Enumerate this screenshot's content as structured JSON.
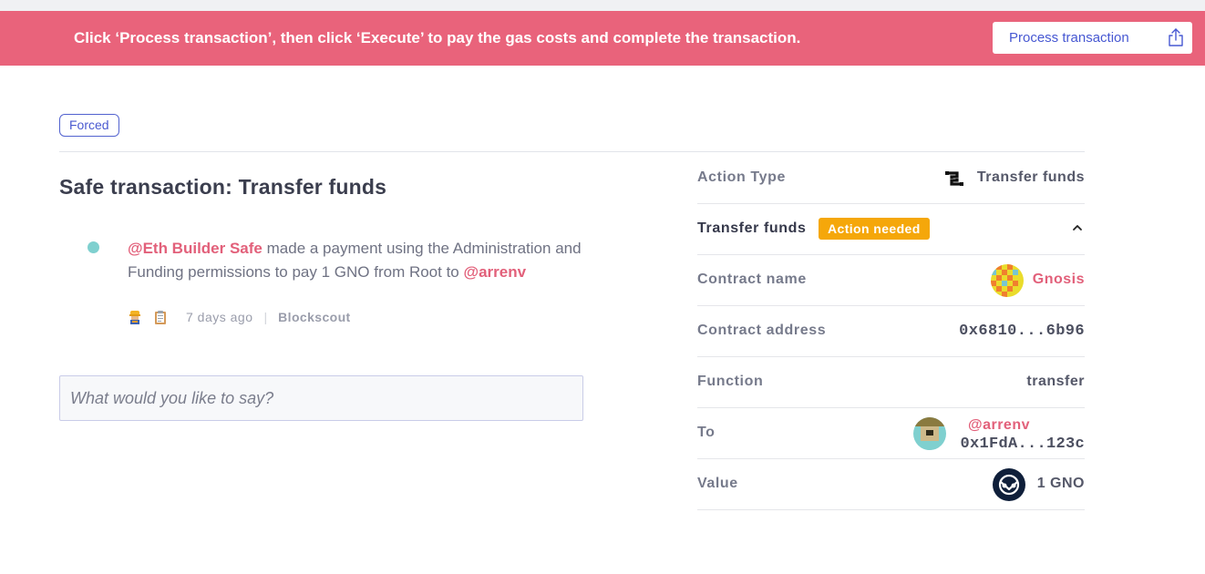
{
  "banner": {
    "message": "Click ‘Process transaction’, then click ‘Execute’ to pay the gas costs and complete the transaction.",
    "button_label": "Process transaction",
    "button_icon": "share-upload-icon",
    "background": "#e9637b"
  },
  "badge": {
    "label": "Forced"
  },
  "title": "Safe transaction: Transfer funds",
  "activity": {
    "actor": "@Eth Builder Safe",
    "text": "made a payment using the Administration and Funding permissions to pay 1 GNO from Root to",
    "recipient": "@arrenv",
    "time_ago": "7 days ago",
    "source": "Blockscout"
  },
  "comment": {
    "placeholder": "What would you like to say?"
  },
  "details": {
    "action_type": {
      "label": "Action Type",
      "value": "Transfer funds"
    },
    "section": {
      "label": "Transfer funds",
      "status": "Action needed"
    },
    "contract_name": {
      "label": "Contract name",
      "value": "Gnosis"
    },
    "contract_address": {
      "label": "Contract address",
      "value": "0x6810...6b96"
    },
    "function": {
      "label": "Function",
      "value": "transfer"
    },
    "to": {
      "label": "To",
      "name": "@arrenv",
      "address": "0x1FdA...123c"
    },
    "value": {
      "label": "Value",
      "value": "1 GNO"
    }
  },
  "colors": {
    "accent": "#e2607a",
    "primary": "#4758d2",
    "warning": "#f5a70a"
  }
}
